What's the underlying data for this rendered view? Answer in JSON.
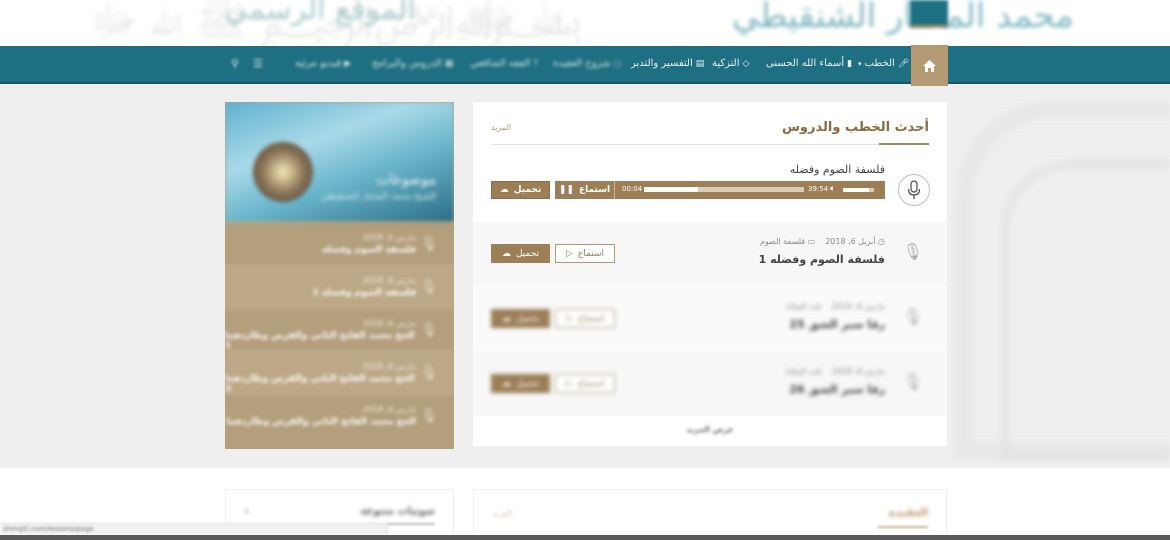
{
  "header": {
    "logo_text": "محمد المختار الشنقيطي",
    "logo_text_left": "الموقع الرسمي"
  },
  "nav": {
    "items": [
      {
        "label": "الخطب",
        "icon": "microphone-icon"
      },
      {
        "label": "أسماء الله الحسنى",
        "icon": "bookmark-icon"
      },
      {
        "label": "التزكية",
        "icon": "diamond-icon"
      },
      {
        "label": "التفسير والتدبر",
        "icon": "book-icon"
      },
      {
        "label": "شروح العقيدة",
        "icon": "bulb-icon"
      },
      {
        "label": "الفقه الشافعي",
        "icon": "question-icon"
      },
      {
        "label": "الدروس والبرامج",
        "icon": "film-icon"
      },
      {
        "label": "فيديو مرئية",
        "icon": "video-icon"
      }
    ]
  },
  "latest": {
    "title": "أحدث الخطب والدروس",
    "more": "المزيد",
    "featured": {
      "title": "فلسفة الصوم وفضله",
      "listen": "استماع",
      "download": "تحميل",
      "current_time": "00:04",
      "total_time": "39:54",
      "progress": 0.34,
      "volume": 0.85
    },
    "rows": [
      {
        "date": "أبريل 6, 2018",
        "category": "فلسفة الصوم",
        "title": "فلسفة الصوم وفضله 1",
        "listen": "استماع",
        "download": "تحميل"
      },
      {
        "date": "مارس 6, 2018",
        "category": "ثلث الصلاة",
        "title": "رقا سبر الشق 25",
        "listen": "استماع",
        "download": "تحميل"
      },
      {
        "date": "مارس 6, 2018",
        "category": "ثلث الصلاة",
        "title": "رقا سبر الشق 26",
        "listen": "استماع",
        "download": "تحميل"
      }
    ],
    "show_more": "عرض المزيد"
  },
  "sidebar": {
    "hero_title": "موضوعات",
    "hero_sub": "الشيخ محمد المختار الشنقيطي",
    "items": [
      {
        "date": "مارس 6, 2018",
        "title": "فلسفة الصوم وفضله"
      },
      {
        "date": "مارس 6, 2018",
        "title": "فلسفة الصوم وفضله 1"
      },
      {
        "date": "مارس 6, 2018",
        "title": "الحج محمد الفاتح الثاني والقرص وطاردهما 1"
      },
      {
        "date": "مارس 6, 2018",
        "title": "الحج محمد الفاتح الثاني والقرص وطاردهما 2"
      },
      {
        "date": "مارس 6, 2018",
        "title": "الحج محمد الفاتح الثاني والقرص وطاردهما"
      }
    ]
  },
  "lower": {
    "right_title": "العقيدة",
    "right_more": "المزيد",
    "left_title": "صوتيات متنوعة",
    "left_icon": "x"
  },
  "status": {
    "url": "shinqiti.com/lessons/page"
  },
  "colors": {
    "nav": "#1e6f81",
    "accent": "#9c7f57",
    "home_tab": "#b49a73"
  }
}
